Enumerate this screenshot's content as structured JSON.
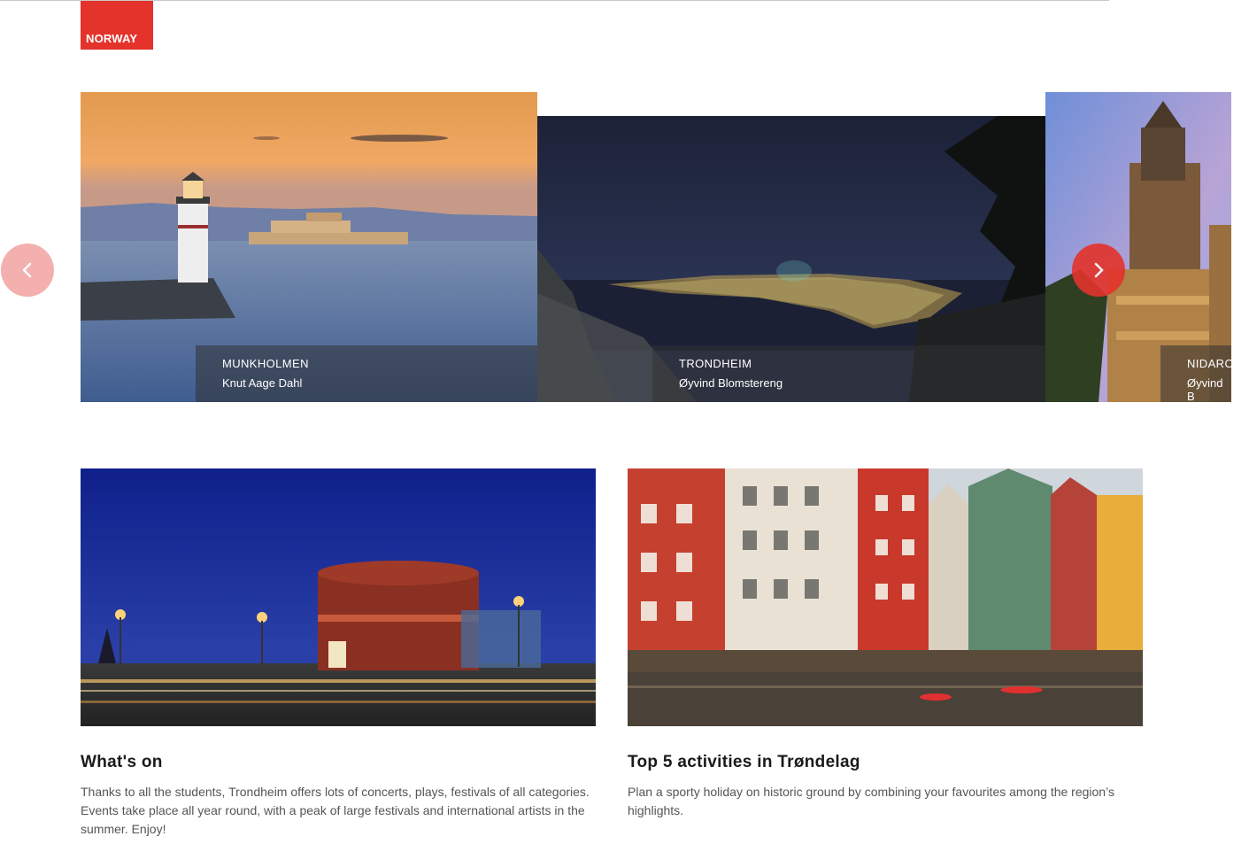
{
  "header": {
    "logo_text": "NORWAY"
  },
  "carousel": {
    "slides": [
      {
        "title": "MUNKHOLMEN",
        "credit": "Knut Aage Dahl"
      },
      {
        "title": "TRONDHEIM",
        "credit": "Øyvind Blomstereng"
      },
      {
        "title": "NIDARO",
        "credit": "Øyvind B"
      }
    ],
    "prev_icon": "chevron-left-icon",
    "next_icon": "chevron-right-icon"
  },
  "cards": [
    {
      "title": "What's on",
      "text": "Thanks to all the students, Trondheim offers lots of concerts, plays, festivals of all categories. Events take place all year round, with a peak of large festivals and international artists in the summer. Enjoy!"
    },
    {
      "title": "Top 5 activities in Trøndelag",
      "text": "Plan a sporty holiday on historic ground by combining your favourites among the region’s highlights."
    }
  ],
  "colors": {
    "brand": "#e3332b",
    "caption_bg": "#323232",
    "text_muted": "#555555"
  }
}
